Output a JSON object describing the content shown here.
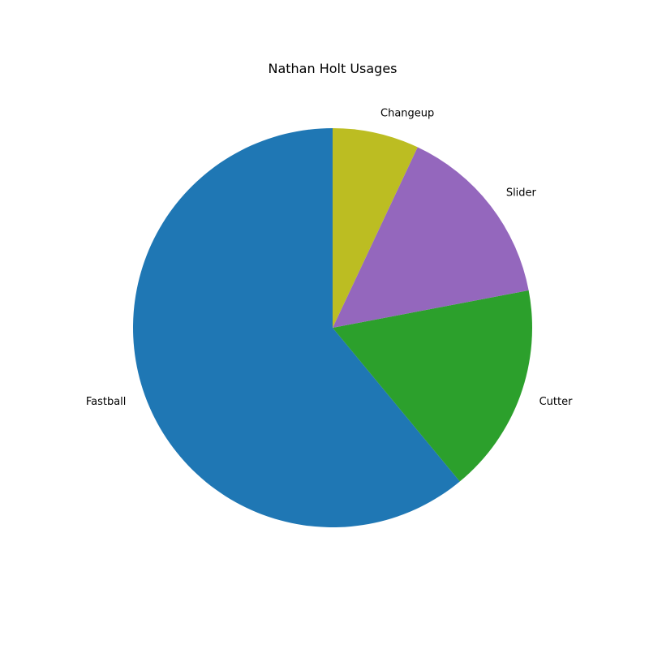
{
  "chart_data": {
    "type": "pie",
    "title": "Nathan Holt Usages",
    "categories": [
      "Fastball",
      "Cutter",
      "Slider",
      "Changeup"
    ],
    "values": [
      61,
      17,
      15,
      7
    ],
    "colors": [
      "#1f77b4",
      "#2ca02c",
      "#9467bd",
      "#bcbd22"
    ],
    "start_angle_deg": 90,
    "direction": "counterclockwise",
    "legend": false
  }
}
